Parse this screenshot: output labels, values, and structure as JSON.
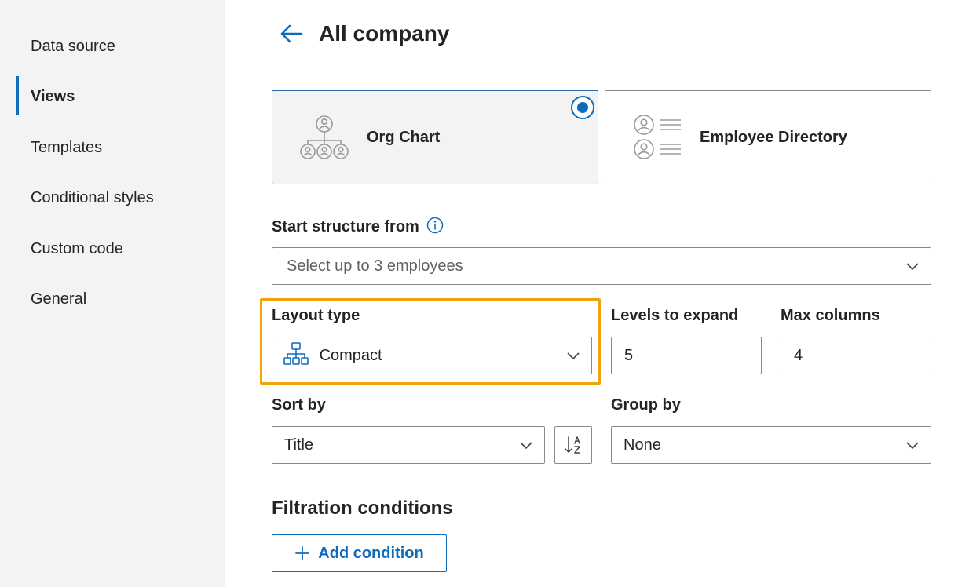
{
  "sidebar": {
    "items": [
      {
        "label": "Data source",
        "active": false
      },
      {
        "label": "Views",
        "active": true
      },
      {
        "label": "Templates",
        "active": false
      },
      {
        "label": "Conditional styles",
        "active": false
      },
      {
        "label": "Custom code",
        "active": false
      },
      {
        "label": "General",
        "active": false
      }
    ]
  },
  "header": {
    "back_icon": "arrow-left-icon",
    "title": "All company"
  },
  "views": [
    {
      "label": "Org Chart",
      "icon": "org-chart-icon",
      "selected": true
    },
    {
      "label": "Employee Directory",
      "icon": "employee-directory-icon",
      "selected": false
    }
  ],
  "start_structure": {
    "label": "Start structure from",
    "info_icon": "info-icon",
    "placeholder": "Select up to 3 employees"
  },
  "layout_type": {
    "label": "Layout type",
    "value": "Compact",
    "icon": "hierarchy-icon"
  },
  "levels_to_expand": {
    "label": "Levels to expand",
    "value": "5"
  },
  "max_columns": {
    "label": "Max columns",
    "value": "4"
  },
  "sort_by": {
    "label": "Sort by",
    "value": "Title",
    "direction_icon": "sort-ascending-icon"
  },
  "group_by": {
    "label": "Group by",
    "value": "None"
  },
  "filtration": {
    "title": "Filtration conditions",
    "add_button_label": "Add condition"
  },
  "colors": {
    "accent": "#0f6cbd",
    "highlight": "#f0a30a",
    "sidebar_bg": "#f3f3f3"
  }
}
